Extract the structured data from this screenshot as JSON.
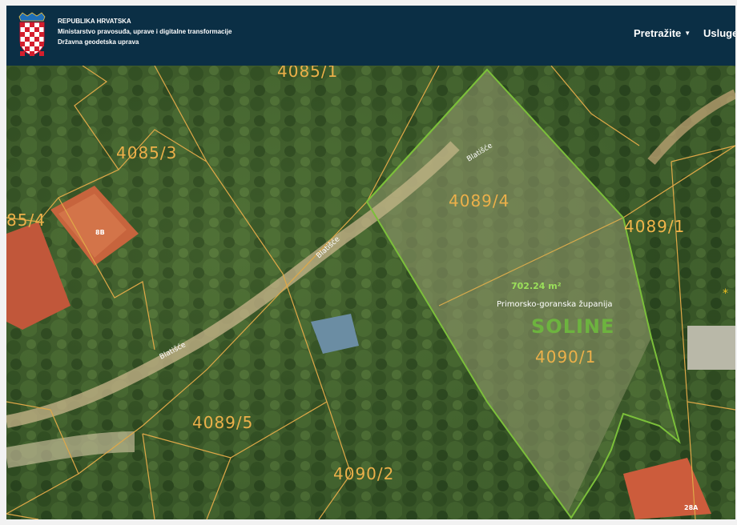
{
  "header": {
    "org_line1": "REPUBLIKA HRVATSKA",
    "org_line2": "Ministarstvo pravosuđa, uprave i digitalne transformacije",
    "org_line3": "Državna geodetska uprava",
    "nav": [
      {
        "label": "Pretražite",
        "icon": "chevron-down-icon"
      },
      {
        "label": "Usluge",
        "icon": "chevron-down-icon"
      }
    ],
    "crest_icon": "croatia-coat-of-arms-icon"
  },
  "map": {
    "parcels": [
      "4085/1",
      "4085/3",
      "85/4",
      "4089/4",
      "4089/1",
      "4090/1",
      "4089/5",
      "4090/2"
    ],
    "roads": [
      "Blatišće",
      "Blatišće",
      "Blatišće"
    ],
    "houses": [
      "8B",
      "28A"
    ],
    "area": "702.24 m²",
    "county": "Primorsko-goranska županija",
    "municipality": "SOLINE",
    "colors": {
      "parcel_line": "#e0a848",
      "selection": "#7bbf3a",
      "header_bg": "#0b2f45"
    }
  }
}
